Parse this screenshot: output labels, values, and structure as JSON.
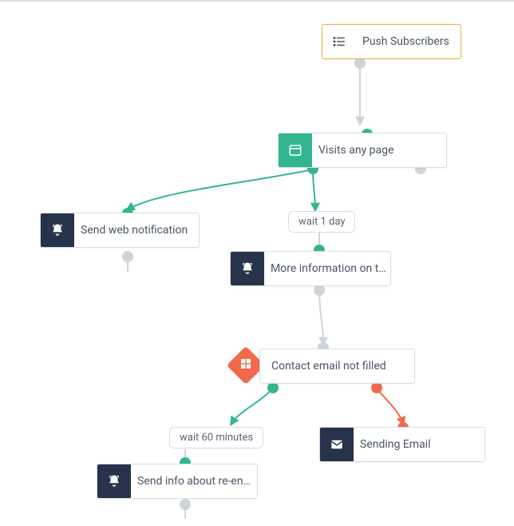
{
  "nodes": {
    "push": {
      "label": "Push Subscribers"
    },
    "trigger": {
      "label": "Visits any page"
    },
    "web_notif": {
      "label": "Send web notification"
    },
    "more_info": {
      "label": "More information on t…"
    },
    "condition": {
      "label": "Contact email not filled"
    },
    "send_email": {
      "label": "Sending Email"
    },
    "reenroll": {
      "label": "Send info about re-en…"
    }
  },
  "waits": {
    "wait1": "wait 1 day",
    "wait60": "wait 60 minutes"
  },
  "colors": {
    "green": "#33b690",
    "orange": "#f26a4b",
    "dark": "#26334a",
    "gray": "#cfd4da",
    "selected": "#e8b339"
  }
}
